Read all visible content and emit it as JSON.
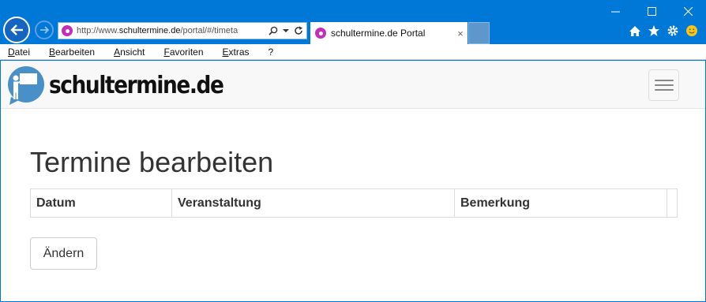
{
  "browser": {
    "url_prefix": "http://www.",
    "url_domain": "schultermine.de",
    "url_suffix": "/portal/#/timeta",
    "tab_title": "schultermine.de Portal",
    "tab_close": "×"
  },
  "menu": {
    "items": [
      {
        "label": "Datei"
      },
      {
        "label": "Bearbeiten"
      },
      {
        "label": "Ansicht"
      },
      {
        "label": "Favoriten"
      },
      {
        "label": "Extras"
      },
      {
        "label": "?"
      }
    ]
  },
  "site": {
    "logo_text": "schultermine.de"
  },
  "main": {
    "title": "Termine bearbeiten",
    "table_headers": [
      "Datum",
      "Veranstaltung",
      "Bemerkung",
      ""
    ],
    "change_button": "Ändern"
  },
  "icons": {
    "back": "arrow-left-icon",
    "forward": "arrow-right-icon",
    "home": "home-icon",
    "favorites": "star-icon",
    "tools": "gear-icon",
    "feedback": "smiley-icon"
  },
  "colors": {
    "chrome_blue": "#0078d7",
    "site_icon": "#c42fb8",
    "logo_blue": "#4a90c8"
  }
}
